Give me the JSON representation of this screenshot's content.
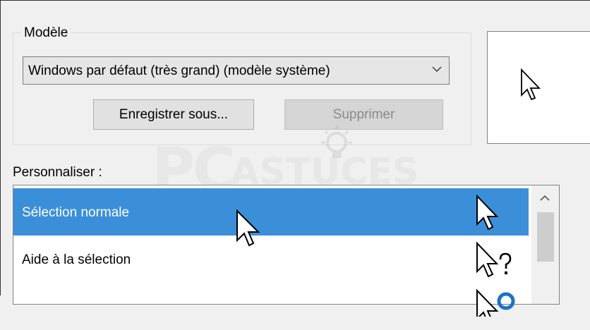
{
  "model_group": {
    "legend": "Modèle",
    "scheme_select": {
      "value": "Windows par défaut (très grand) (modèle système)"
    },
    "save_as_label": "Enregistrer sous...",
    "delete_label": "Supprimer"
  },
  "customize": {
    "label": "Personnaliser :",
    "items": [
      {
        "label": "Sélection normale",
        "icon": "arrow-cursor-icon",
        "selected": true
      },
      {
        "label": "Aide à la sélection",
        "icon": "help-cursor-icon",
        "selected": false
      },
      {
        "label": "",
        "icon": "working-cursor-icon",
        "selected": false
      }
    ]
  },
  "watermark": {
    "text_main": "PC",
    "text_sub": "ASTUCES"
  },
  "colors": {
    "selection": "#3b8fd9",
    "window_bg": "#f0f0f0",
    "busy_ring": "#1a73c8"
  }
}
